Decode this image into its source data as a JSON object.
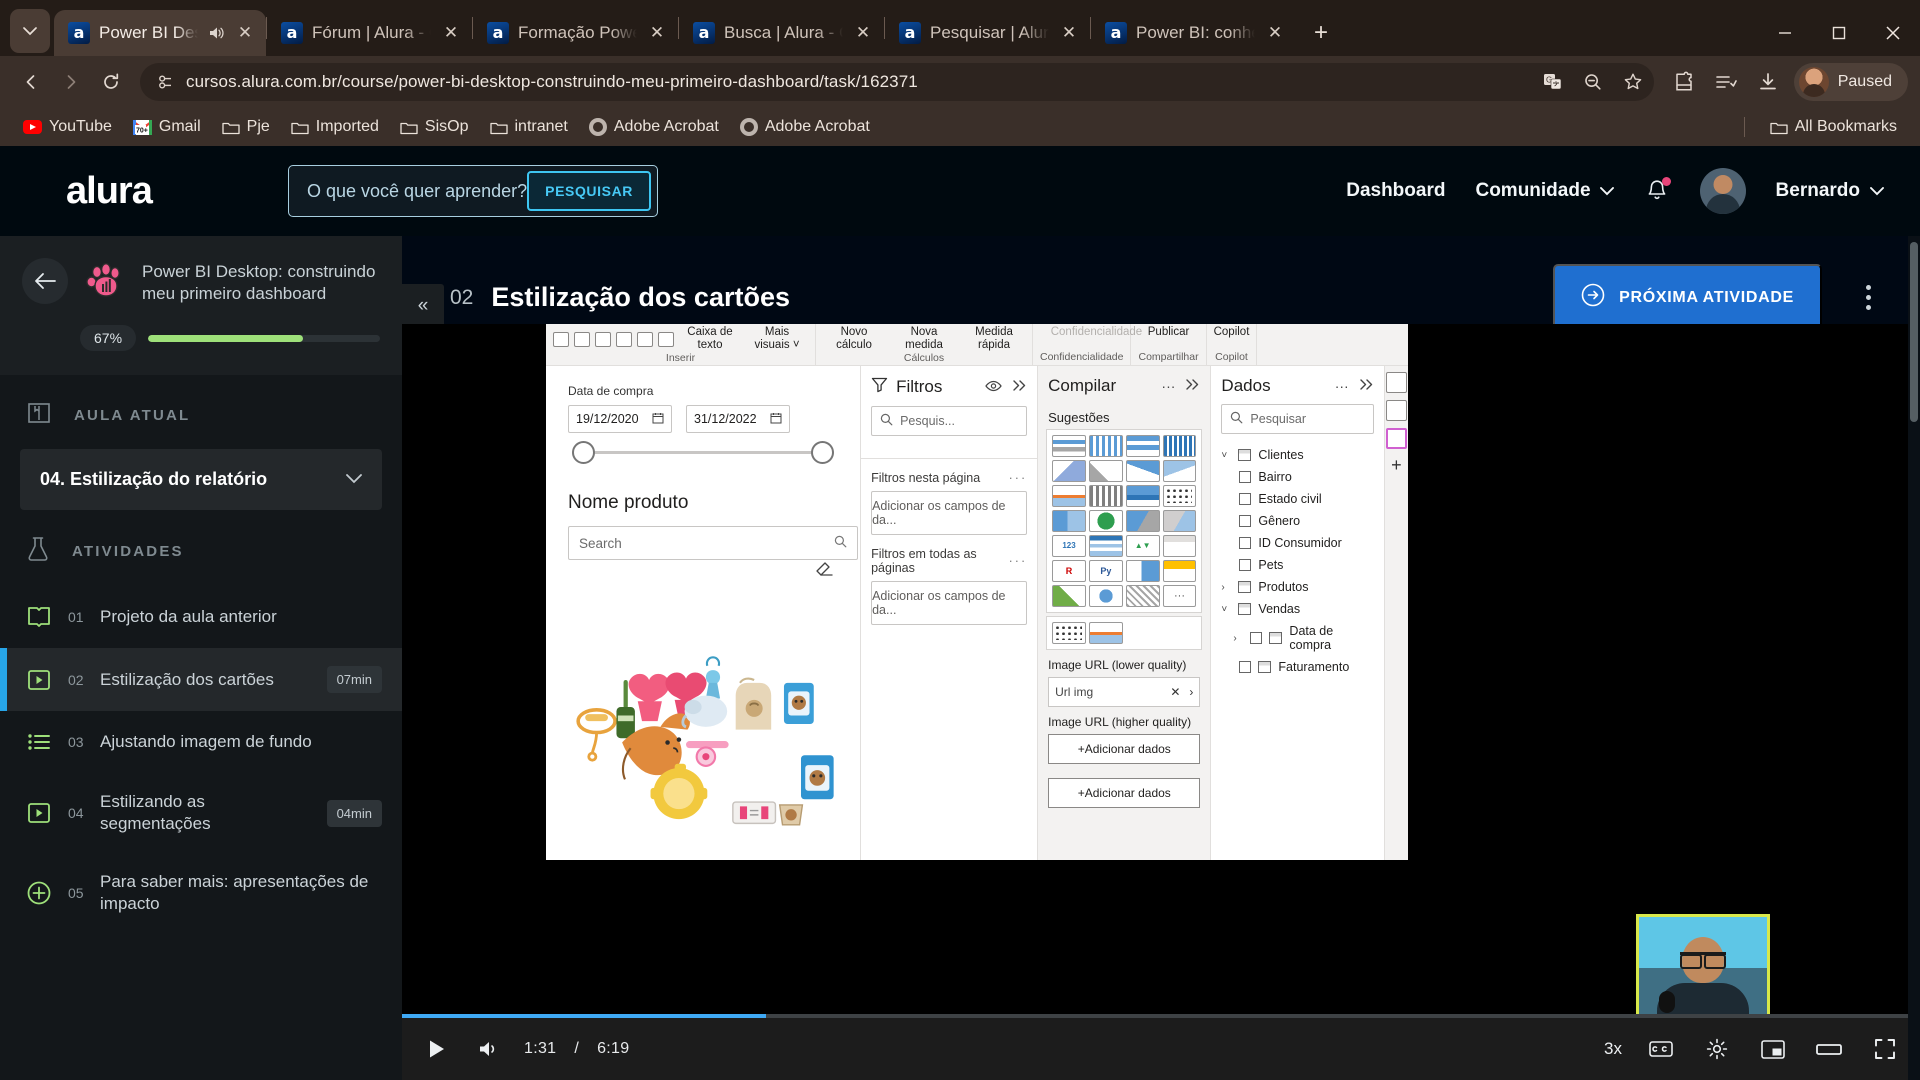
{
  "browser": {
    "tabs": [
      {
        "title": "Power BI Deskt",
        "active": true,
        "audio": true
      },
      {
        "title": "Fórum | Alura - Cu",
        "active": false,
        "audio": false
      },
      {
        "title": "Formação Power B",
        "active": false,
        "audio": false
      },
      {
        "title": "Busca | Alura - Curs",
        "active": false,
        "audio": false
      },
      {
        "title": "Pesquisar | Alura - ",
        "active": false,
        "audio": false
      },
      {
        "title": "Power BI: conhecer",
        "active": false,
        "audio": false
      }
    ],
    "favicon_letter": "a",
    "new_tab_label": "+",
    "window_controls": {
      "minimize": "minimize-icon",
      "maximize": "maximize-icon",
      "close": "close-icon"
    },
    "url": "cursos.alura.com.br/course/power-bi-desktop-construindo-meu-primeiro-dashboard/task/162371",
    "toolbar_icons": [
      "translate-icon",
      "zoom-out-icon",
      "bookmark-star-icon",
      "extensions-icon",
      "reading-list-icon",
      "downloads-icon"
    ],
    "profile": {
      "label": "Paused"
    },
    "bookmarks": [
      {
        "label": "YouTube",
        "icon": "youtube-icon"
      },
      {
        "label": "Gmail",
        "icon": "gmail-icon"
      },
      {
        "label": "Pje",
        "icon": "folder-icon"
      },
      {
        "label": "Imported",
        "icon": "folder-icon"
      },
      {
        "label": "SisOp",
        "icon": "folder-icon"
      },
      {
        "label": "intranet",
        "icon": "folder-icon"
      },
      {
        "label": "Adobe Acrobat",
        "icon": "adobe-icon"
      },
      {
        "label": "Adobe Acrobat",
        "icon": "adobe-icon"
      }
    ],
    "all_bookmarks_label": "All Bookmarks"
  },
  "site_nav": {
    "logo_text": "alura",
    "search_placeholder": "O que você quer aprender?",
    "search_value": "",
    "search_button": "PESQUISAR",
    "links": {
      "dashboard": "Dashboard",
      "comunidade": "Comunidade"
    },
    "user_name": "Bernardo"
  },
  "sidebar": {
    "course_title": "Power BI Desktop: construindo meu primeiro dashboard",
    "progress_percent": "67%",
    "progress_value": 67,
    "section_aula_label": "AULA ATUAL",
    "current_aula": "04. Estilização do relatório",
    "section_atividades_label": "ATIVIDADES",
    "activities": [
      {
        "num": "01",
        "label": "Projeto da aula anterior",
        "duration": "",
        "icon": "book-icon",
        "active": false
      },
      {
        "num": "02",
        "label": "Estilização dos cartões",
        "duration": "07min",
        "icon": "video-icon",
        "active": true
      },
      {
        "num": "03",
        "label": "Ajustando imagem de fundo",
        "duration": "",
        "icon": "list-icon",
        "active": false
      },
      {
        "num": "04",
        "label": "Estilizando as segmentações",
        "duration": "04min",
        "icon": "video-icon",
        "active": false
      },
      {
        "num": "05",
        "label": "Para saber mais: apresentações de impacto",
        "duration": "",
        "icon": "plus-circle-icon",
        "active": false
      }
    ]
  },
  "main": {
    "task_number": "02",
    "task_title": "Estilização dos cartões",
    "next_button": "PRÓXIMA ATIVIDADE",
    "collapse_label": "«"
  },
  "video": {
    "current_time": "1:31",
    "duration": "6:19",
    "separator": "/",
    "speed": "3x",
    "progress_percent": 24,
    "controls": [
      "play-icon",
      "volume-icon",
      "captions-icon",
      "settings-icon",
      "pip-icon",
      "theater-icon",
      "fullscreen-icon"
    ]
  },
  "powerbi": {
    "ribbon": [
      {
        "items": [
          "Caixa de texto",
          "Mais visuais ˅"
        ],
        "caption": "Inserir",
        "dim": false
      },
      {
        "items": [
          "Novo cálculo",
          "Nova medida",
          "Medida rápida"
        ],
        "caption": "Cálculos",
        "dim": false
      },
      {
        "items": [
          "Confidencialidade"
        ],
        "caption": "Confidencialidade",
        "dim": true
      },
      {
        "items": [
          "Publicar"
        ],
        "caption": "Compartilhar",
        "dim": false
      },
      {
        "items": [
          "Copilot"
        ],
        "caption": "Copilot",
        "dim": false
      }
    ],
    "canvas": {
      "date_slicer_label": "Data de compra",
      "date_from": "19/12/2020",
      "date_to": "31/12/2022",
      "product_label": "Nome produto",
      "search_placeholder": "Search"
    },
    "filters_pane": {
      "title": "Filtros",
      "search_placeholder": "Pesquis...",
      "section_page": "Filtros nesta página",
      "dropzone_page": "Adicionar os campos de da...",
      "section_all": "Filtros em todas as páginas",
      "dropzone_all": "Adicionar os campos de da..."
    },
    "build_pane": {
      "title": "Compilar",
      "suggestions_label": "Sugestões",
      "url_low_label": "Image URL (lower quality)",
      "url_low_value": "Url img",
      "url_high_label": "Image URL (higher quality)",
      "add_button_1": "+Adicionar dados",
      "add_button_2": "+Adicionar dados"
    },
    "data_pane": {
      "title": "Dados",
      "search_placeholder": "Pesquisar",
      "tree": [
        {
          "label": "Clientes",
          "type": "table",
          "expanded": true,
          "indent": 0
        },
        {
          "label": "Bairro",
          "type": "field",
          "indent": 1
        },
        {
          "label": "Estado civil",
          "type": "field",
          "indent": 1
        },
        {
          "label": "Gênero",
          "type": "field",
          "indent": 1
        },
        {
          "label": "ID Consumidor",
          "type": "field",
          "indent": 1
        },
        {
          "label": "Pets",
          "type": "field",
          "indent": 1
        },
        {
          "label": "Produtos",
          "type": "table",
          "expanded": false,
          "indent": 0
        },
        {
          "label": "Vendas",
          "type": "table",
          "expanded": true,
          "indent": 0
        },
        {
          "label": "Data de compra",
          "type": "date",
          "indent": 1
        },
        {
          "label": "Faturamento",
          "type": "field",
          "indent": 1
        }
      ]
    }
  }
}
